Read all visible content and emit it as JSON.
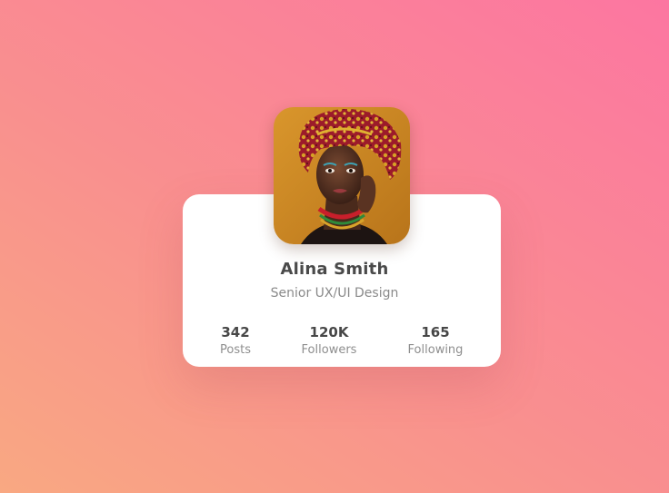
{
  "profile": {
    "name": "Alina Smith",
    "role": "Senior UX/UI Design",
    "avatar_icon": "portrait-photo"
  },
  "stats": [
    {
      "value": "342",
      "label": "Posts"
    },
    {
      "value": "120K",
      "label": "Followers"
    },
    {
      "value": "165",
      "label": "Following"
    }
  ],
  "colors": {
    "background_start": "#f9a882",
    "background_end": "#fc76a1",
    "card": "#ffffff",
    "name_text": "#4a4a4a",
    "muted_text": "#8a8a8a"
  }
}
